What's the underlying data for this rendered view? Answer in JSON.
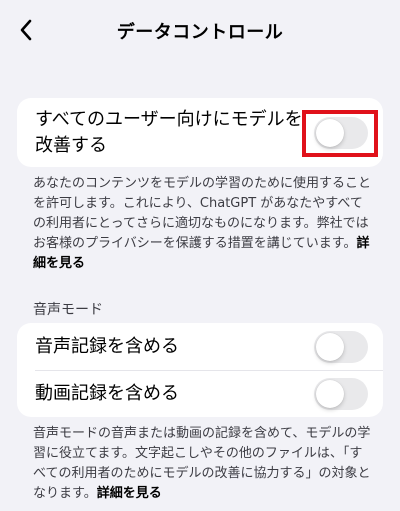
{
  "nav": {
    "title": "データコントロール",
    "back_icon": "chevron-left-icon"
  },
  "improve_model": {
    "label": "すべてのユーザー向けにモデルを改善する",
    "toggle_on": false
  },
  "improve_desc": {
    "text": "あなたのコンテンツをモデルの学習のために使用することを許可します。これにより、ChatGPT があなたやすべての利用者にとってさらに適切なものになります。弊社ではお客様のプライバシーを保護する措置を講じています。",
    "link": "詳細を見る"
  },
  "voice_section": {
    "header": "音声モード",
    "items": [
      {
        "label": "音声記録を含める",
        "toggle_on": false
      },
      {
        "label": "動画記録を含める",
        "toggle_on": false
      }
    ]
  },
  "voice_desc": {
    "text": "音声モードの音声または動画の記録を含めて、モデルの学習に役立てます。文字起こしやその他のファイルは、「すべての利用者のためにモデルの改善に協力する」の対象となります。",
    "link": "詳細を見る"
  },
  "colors": {
    "background": "#f2f2f7",
    "card": "#ffffff",
    "toggle_off": "#e9e9eb",
    "highlight": "#e0111a"
  }
}
